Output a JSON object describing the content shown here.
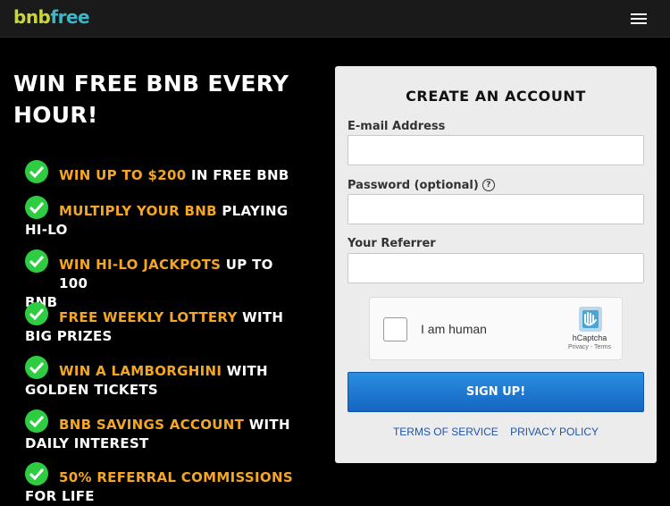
{
  "header": {
    "logo_part1": "bnb",
    "logo_part2": "free"
  },
  "hero": {
    "headline_line1": "WIN FREE BNB EVERY",
    "headline_line2": "HOUR!"
  },
  "features": [
    {
      "highlight": "WIN UP TO $200",
      "rest": " IN FREE BNB",
      "cont": ""
    },
    {
      "highlight": "MULTIPLY YOUR BNB",
      "rest": " PLAYING",
      "cont": "HI-LO"
    },
    {
      "highlight": "WIN HI-LO JACKPOTS",
      "rest": " UP TO 100",
      "cont": "BNB"
    },
    {
      "highlight": "FREE WEEKLY LOTTERY",
      "rest": " WITH",
      "cont": "BIG PRIZES"
    },
    {
      "highlight": "WIN A LAMBORGHINI",
      "rest": " WITH",
      "cont": "GOLDEN TICKETS"
    },
    {
      "highlight": "BNB SAVINGS ACCOUNT",
      "rest": " WITH",
      "cont": "DAILY INTEREST"
    },
    {
      "highlight": "50% REFERRAL COMMISSIONS",
      "rest": "",
      "cont": "FOR LIFE"
    }
  ],
  "form": {
    "title": "CREATE AN ACCOUNT",
    "email_label": "E-mail Address",
    "email_value": "",
    "password_label": "Password (optional)",
    "password_help": "?",
    "password_value": "",
    "referrer_label": "Your Referrer",
    "referrer_value": "",
    "captcha_text": "I am human",
    "captcha_brand": "hCaptcha",
    "captcha_links": "Privacy - Terms",
    "signup_label": "SIGN UP!",
    "terms_link": "TERMS OF SERVICE",
    "privacy_link": "PRIVACY POLICY"
  },
  "colors": {
    "highlight": "#f5a623",
    "check": "#2ecc40",
    "button": "#1976d2",
    "link": "#1f55a8"
  }
}
